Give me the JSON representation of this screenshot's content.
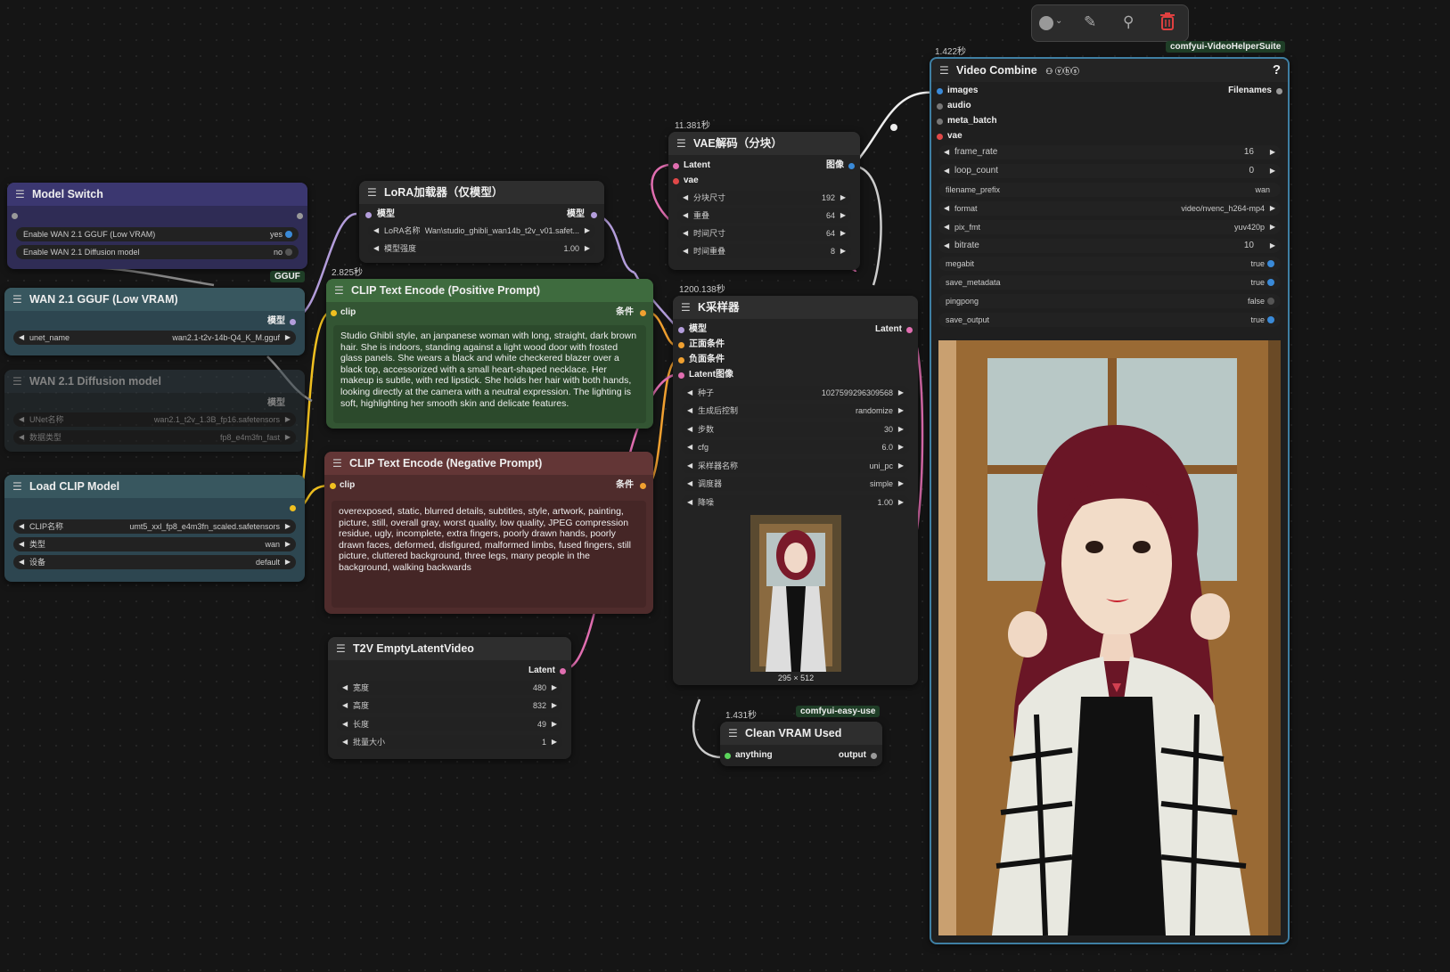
{
  "toolbar": {
    "color_icon": "color-circle-icon",
    "node_icon": "node-icon",
    "pin_icon": "pin-icon",
    "delete_icon": "trash-icon"
  },
  "colors": {
    "green": "#3c7a3c",
    "red": "#7a3636",
    "purple": "#3a3566",
    "teal": "#33505d",
    "video_border": "#3f7fa3",
    "pink": "#e06eb0",
    "yellow": "#f0c020",
    "lavender": "#b39ddb",
    "orange": "#f0a030"
  },
  "model_switch": {
    "title": "Model Switch",
    "opt1_label": "Enable WAN 2.1 GGUF (Low VRAM)",
    "opt1_value": "yes",
    "opt2_label": "Enable WAN 2.1 Diffusion model",
    "opt2_value": "no"
  },
  "gguf": {
    "badge": "GGUF",
    "title": "WAN 2.1 GGUF (Low VRAM)",
    "out_label": "模型",
    "w1_label": "unet_name",
    "w1_value": "wan2.1-t2v-14b-Q4_K_M.gguf"
  },
  "diffusion": {
    "title": "WAN 2.1 Diffusion model",
    "out_label": "模型",
    "w1_label": "UNet名称",
    "w1_value": "wan2.1_t2v_1.3B_fp16.safetensors",
    "w2_label": "数据类型",
    "w2_value": "fp8_e4m3fn_fast"
  },
  "clip_loader": {
    "title": "Load CLIP Model",
    "w1_label": "CLIP名称",
    "w1_value": "umt5_xxl_fp8_e4m3fn_scaled.safetensors",
    "w2_label": "类型",
    "w2_value": "wan",
    "w3_label": "设备",
    "w3_value": "default"
  },
  "lora": {
    "title": "LoRA加载器（仅模型）",
    "in_label": "模型",
    "out_label": "模型",
    "w1_label": "LoRA名称",
    "w1_value": "Wan\\studio_ghibli_wan14b_t2v_v01.safet...",
    "w2_label": "模型强度",
    "w2_value": "1.00"
  },
  "positive": {
    "timer": "2.825秒",
    "title": "CLIP Text Encode (Positive Prompt)",
    "in_label": "clip",
    "out_label": "条件",
    "text": "Studio Ghibli style, an janpanese woman with long, straight, dark brown hair. She is indoors, standing against a light wood door with frosted glass panels. She wears a black and white checkered blazer over a black top, accessorized with a small heart-shaped necklace. Her makeup is subtle, with red lipstick. She holds her hair with both hands, looking directly at the camera with a neutral expression. The lighting is soft, highlighting her smooth skin and delicate features."
  },
  "negative": {
    "title": "CLIP Text Encode (Negative Prompt)",
    "in_label": "clip",
    "out_label": "条件",
    "text": "overexposed, static, blurred details, subtitles, style, artwork, painting, picture, still, overall gray, worst quality, low quality, JPEG compression residue, ugly, incomplete, extra fingers, poorly drawn hands, poorly drawn faces, deformed, disfigured, malformed limbs, fused fingers, still picture, cluttered background, three legs, many people in the background, walking backwards"
  },
  "latent": {
    "title": "T2V EmptyLatentVideo",
    "out_label": "Latent",
    "w1_label": "宽度",
    "w1_value": "480",
    "w2_label": "高度",
    "w2_value": "832",
    "w3_label": "长度",
    "w3_value": "49",
    "w4_label": "批量大小",
    "w4_value": "1"
  },
  "vae": {
    "timer": "11.381秒",
    "title": "VAE解码（分块）",
    "in1": "Latent",
    "in2": "vae",
    "out": "图像",
    "w1_label": "分块尺寸",
    "w1_value": "192",
    "w2_label": "重叠",
    "w2_value": "64",
    "w3_label": "时间尺寸",
    "w3_value": "64",
    "w4_label": "时间重叠",
    "w4_value": "8"
  },
  "ksampler": {
    "timer": "1200.138秒",
    "title": "K采样器",
    "in1": "模型",
    "in2": "正面条件",
    "in3": "负面条件",
    "in4": "Latent图像",
    "out": "Latent",
    "w1_label": "种子",
    "w1_value": "1027599296309568",
    "w2_label": "生成后控制",
    "w2_value": "randomize",
    "w3_label": "步数",
    "w3_value": "30",
    "w4_label": "cfg",
    "w4_value": "6.0",
    "w5_label": "采样器名称",
    "w5_value": "uni_pc",
    "w6_label": "调度器",
    "w6_value": "simple",
    "w7_label": "降噪",
    "w7_value": "1.00",
    "preview_size": "295 × 512"
  },
  "clean": {
    "timer": "1.431秒",
    "tag": "comfyui-easy-use",
    "title": "Clean VRAM Used",
    "in": "anything",
    "out": "output"
  },
  "video": {
    "timer": "1.422秒",
    "tag": "comfyui-VideoHelperSuite",
    "title": "Video Combine",
    "help": "?",
    "in1": "images",
    "in2": "audio",
    "in3": "meta_batch",
    "in4": "vae",
    "out": "Filenames",
    "w1_label": "frame_rate",
    "w1_value": "16",
    "w2_label": "loop_count",
    "w2_value": "0",
    "w3_label": "filename_prefix",
    "w3_value": "wan",
    "w4_label": "format",
    "w4_value": "video/nvenc_h264-mp4",
    "w5_label": "pix_fmt",
    "w5_value": "yuv420p",
    "w6_label": "bitrate",
    "w6_value": "10",
    "t1_label": "megabit",
    "t1_value": "true",
    "t2_label": "save_metadata",
    "t2_value": "true",
    "t3_label": "pingpong",
    "t3_value": "false",
    "t4_label": "save_output",
    "t4_value": "true"
  }
}
